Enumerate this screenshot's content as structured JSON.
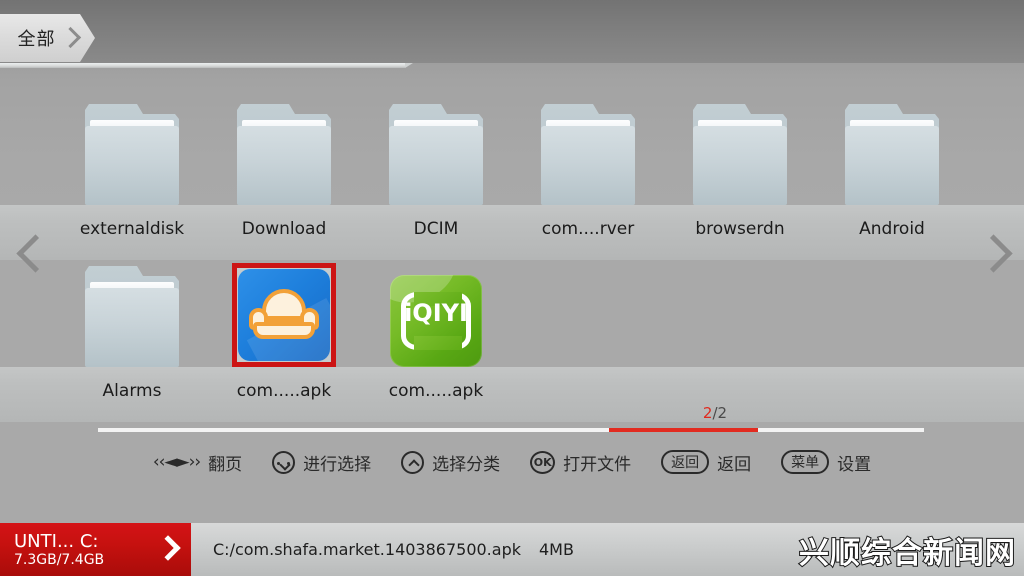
{
  "header": {
    "tab_label": "全部",
    "tab_chevron_icon": "chevron-right-icon"
  },
  "navigation": {
    "prev_icon": "chevron-left-icon",
    "next_icon": "chevron-right-icon"
  },
  "grid": {
    "items": [
      {
        "label": "externaldisk",
        "type": "folder",
        "icon": "folder-icon",
        "selected": false
      },
      {
        "label": "Download",
        "type": "folder",
        "icon": "folder-icon",
        "selected": false
      },
      {
        "label": "DCIM",
        "type": "folder",
        "icon": "folder-icon",
        "selected": false
      },
      {
        "label": "com....rver",
        "type": "folder",
        "icon": "folder-icon",
        "selected": false
      },
      {
        "label": "browserdn",
        "type": "folder",
        "icon": "folder-icon",
        "selected": false
      },
      {
        "label": "Android",
        "type": "folder",
        "icon": "folder-icon",
        "selected": false
      },
      {
        "label": "Alarms",
        "type": "folder",
        "icon": "folder-icon",
        "selected": false
      },
      {
        "label": "com.....apk",
        "type": "app",
        "icon": "shafa-market-icon",
        "selected": true
      },
      {
        "label": "com.....apk",
        "type": "app",
        "icon": "iqiyi-icon",
        "iqiyi_word": "iQIYI",
        "selected": false
      }
    ]
  },
  "pagination": {
    "current": "2",
    "separator_total": "/2",
    "progress_percent": 18
  },
  "hints": [
    {
      "icon": "paging-arrows-icon",
      "glyph": "‹‹◄►››",
      "label": "翻页"
    },
    {
      "icon": "dpad-left-right-down-icon",
      "label": "进行选择"
    },
    {
      "icon": "dpad-up-icon",
      "label": "选择分类"
    },
    {
      "icon": "ok-button-icon",
      "badge": "OK",
      "label": "打开文件"
    },
    {
      "icon": "back-button-icon",
      "badge": "返回",
      "label": "返回"
    },
    {
      "icon": "menu-button-icon",
      "badge": "菜单",
      "label": "设置"
    }
  ],
  "status_bar": {
    "drive_name": "UNTI...  C:",
    "drive_usage": "7.3GB/7.4GB",
    "drive_chevron_icon": "chevron-right-icon",
    "file_path": "C:/com.shafa.market.1403867500.apk",
    "file_size": "4MB",
    "watermark": "兴顺综合新闻网"
  },
  "colors": {
    "selection_red": "#cc1414",
    "progress_red": "#e22b20",
    "drive_red": "#c6110f",
    "folder_blue_gray": "#c8d3d8",
    "shafa_blue": "#1e7fdc",
    "iqiyi_green": "#76bb27"
  }
}
